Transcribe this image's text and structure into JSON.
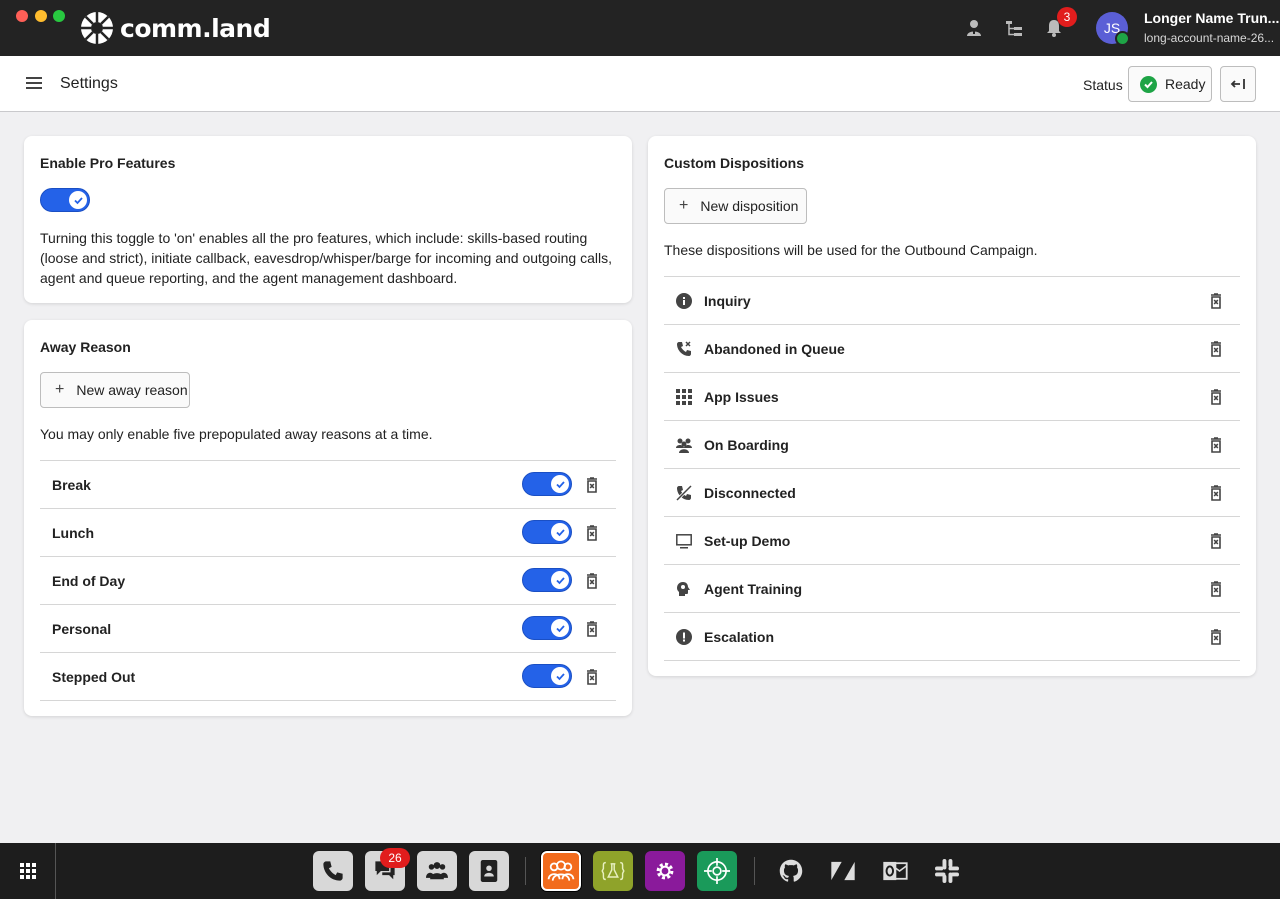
{
  "window": {
    "app_name": "comm.land",
    "notification_count": "3",
    "user": {
      "initials": "JS",
      "name": "Longer Name Trun...",
      "account": "long-account-name-26..."
    }
  },
  "header": {
    "title": "Settings",
    "status_label": "Status",
    "status_value": "Ready"
  },
  "pro_features": {
    "title": "Enable Pro Features",
    "enabled": true,
    "description": "Turning this toggle to 'on' enables all the pro features, which include: skills-based routing (loose and strict), initiate callback, eavesdrop/whisper/barge for incoming and outgoing calls, agent and queue reporting, and the agent management dashboard."
  },
  "away_reason": {
    "title": "Away Reason",
    "new_button": "New away reason",
    "note": "You may only enable five prepopulated away reasons at a time.",
    "items": [
      {
        "label": "Break",
        "enabled": true
      },
      {
        "label": "Lunch",
        "enabled": true
      },
      {
        "label": "End of Day",
        "enabled": true
      },
      {
        "label": "Personal",
        "enabled": true
      },
      {
        "label": "Stepped Out",
        "enabled": true
      }
    ]
  },
  "custom_dispositions": {
    "title": "Custom Dispositions",
    "new_button": "New disposition",
    "note": "These dispositions will be used for the Outbound Campaign.",
    "items": [
      {
        "label": "Inquiry",
        "icon": "info-icon"
      },
      {
        "label": "Abandoned in Queue",
        "icon": "phone-missed-icon"
      },
      {
        "label": "App Issues",
        "icon": "apps-grid-icon"
      },
      {
        "label": "On Boarding",
        "icon": "group-icon"
      },
      {
        "label": "Disconnected",
        "icon": "phone-disabled-icon"
      },
      {
        "label": "Set-up Demo",
        "icon": "monitor-icon"
      },
      {
        "label": "Agent Training",
        "icon": "head-brain-icon"
      },
      {
        "label": "Escalation",
        "icon": "alert-circle-icon"
      }
    ]
  },
  "dock": {
    "messages_badge": "26",
    "colors": {
      "active": "#f26b1d",
      "lab": "#8fa32a",
      "settings": "#8a1a9b",
      "target": "#1a9a5a"
    }
  }
}
